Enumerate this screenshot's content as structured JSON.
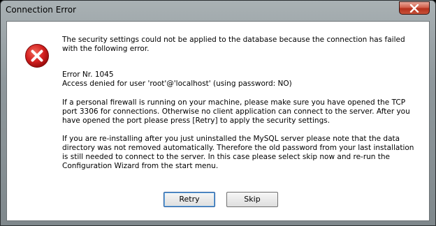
{
  "window": {
    "title": "Connection Error"
  },
  "icon": "error-x-icon",
  "colors": {
    "close_button": "#c7503a",
    "icon_red": "#c81c1c"
  },
  "message": {
    "p1": [
      "The security settings could not be applied to the database because the connection has failed",
      "with the following error."
    ],
    "p2": [
      "Error Nr. 1045",
      "Access denied for user 'root'@'localhost' (using password: NO)"
    ],
    "p3": [
      "If a personal firewall is running on your machine, please make sure you have opened the TCP",
      "port 3306 for connections. Otherwise no client application can connect to the server. After you",
      "have opened the port please press [Retry] to apply the security settings."
    ],
    "p4": [
      "If you are re-installing after you just uninstalled the MySQL server please note that the data",
      "directory was not removed automatically. Therefore the old password from your last installation",
      "is still needed to connect to the server. In this case please select skip now and re-run the",
      "Configuration Wizard from the start menu."
    ]
  },
  "buttons": {
    "retry": "Retry",
    "skip": "Skip"
  }
}
